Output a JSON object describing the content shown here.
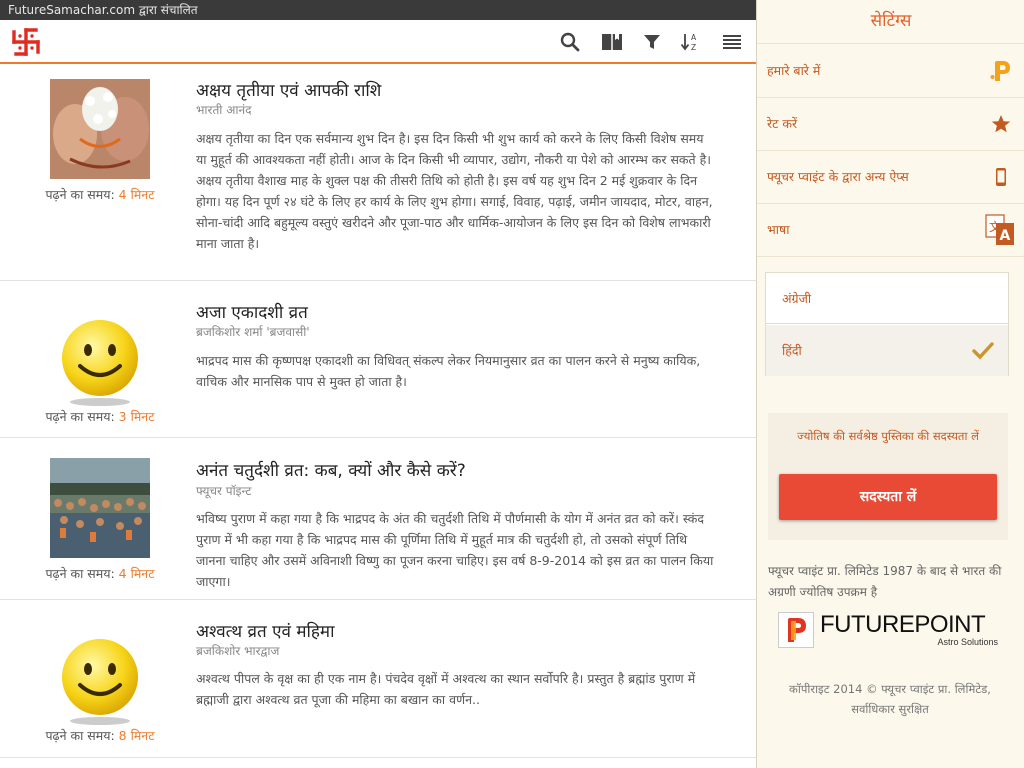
{
  "statusbar": {
    "text": "FutureSamachar.com द्वारा संचालित"
  },
  "toolbar": {
    "icons": [
      "search-icon",
      "book-icon",
      "filter-icon",
      "sort-az-icon",
      "menu-icon"
    ],
    "accent": "#f07a2a",
    "logo_color": "#e02b20",
    "sort_label": "AZ"
  },
  "articles": [
    {
      "title": "अक्षय तृतीया एवं आपकी राशि",
      "author": "भारती आनंद",
      "body": "अक्षय तृतीया का दिन एक सर्वमान्य शुभ दिन है। इस दिन किसी भी शुभ कार्य को करने के लिए किसी विशेष समय या मुहूर्त की आवश्यकता नहीं होती। आज के दिन किसी भी व्यापार, उद्योग, नौकरी या पेशे को आरम्भ कर सकते है। अक्षय तृतीया वैशाख माह के शुक्ल पक्ष की तीसरी तिथि को होती है। इस वर्ष यह शुभ दिन 2 मई शुक्रवार के दिन होगा। यह दिन पूर्ण २४ घंटे के लिए हर कार्य के लिए शुभ होगा। सगाई, विवाह, पढ़ाई, जमीन जायदाद, मोटर, वाहन, सोना-चांदी आदि बहुमूल्य वस्तुएं खरीदने और पूजा-पाठ और धार्मिक-आयोजन के लिए इस दिन को विशेष लाभकारी माना जाता है।",
      "read_label": "पढ़ने का समय:",
      "read_time": "4 मिनट",
      "image": "ritual-photo"
    },
    {
      "title": "अजा एकादशी व्रत",
      "author": "ब्रजकिशोर शर्मा 'ब्रजवासी'",
      "body": "भाद्रपद मास की कृष्णपक्ष एकादशी का विधिवत् संकल्प लेकर नियमानुसार व्रत का पालन करने से मनुष्य कायिक, वाचिक और मानसिक पाप से मुक्त हो जाता है।",
      "read_label": "पढ़ने का समय:",
      "read_time": "3 मिनट",
      "image": "smiley-icon"
    },
    {
      "title": "अनंत चतुर्दशी व्रत: कब, क्यों और कैसे करें?",
      "author": "फ्यूचर पॉइन्ट",
      "body": "भविष्य पुराण में कहा गया है कि भाद्रपद के अंत की चतुर्दशी तिथि में पौर्णमासी के योग में अनंत व्रत को करें। स्कंद पुराण में भी कहा गया है कि भाद्रपद मास की पूर्णिमा तिथि में मुहूर्त मात्र की चतुर्दशी हो, तो उसको संपूर्ण तिथि जानना चाहिए और उसमें अविनाशी विष्णु का पूजन करना चाहिए। इस वर्ष 8-9-2014 को इस व्रत का पालन किया जाएगा।",
      "read_label": "पढ़ने का समय:",
      "read_time": "4 मिनट",
      "image": "crowd-photo"
    },
    {
      "title": "अश्वत्थ व्रत एवं महिमा",
      "author": "ब्रजकिशोर भारद्वाज",
      "body": "अश्वत्थ पीपल के वृक्ष का ही एक नाम है। पंचदेव वृक्षों में अश्वत्थ का स्थान सर्वोपरि है। प्रस्तुत है ब्रह्मांड पुराण में ब्रह्माजी द्वारा अश्वत्थ व्रत पूजा की महिमा का बखान का वर्णन..",
      "read_label": "पढ़ने का समय:",
      "read_time": "8 मिनट",
      "image": "smiley-icon"
    }
  ],
  "drawer": {
    "title": "सेटिंग्स",
    "menu": [
      {
        "label": "हमारे बारे में",
        "icon": "futurepoint-p-icon"
      },
      {
        "label": "रेट करें",
        "icon": "star-icon"
      },
      {
        "label": "फ्यूचर प्वाइंट के द्वारा अन्य ऐप्स",
        "icon": "phone-icon"
      },
      {
        "label": "भाषा",
        "icon": "translate-icon"
      }
    ],
    "languages": [
      {
        "label": "अंग्रेजी",
        "selected": false
      },
      {
        "label": "हिंदी",
        "selected": true
      }
    ],
    "subscribe": {
      "text": "ज्योतिष की सर्वश्रेष्ठ पुस्तिका की सदस्यता लें",
      "button": "सदस्यता लें",
      "button_color": "#e84a35"
    },
    "about": "फ्यूचर प्वाइंट प्रा. लिमिटेड 1987 के बाद से भारत की अग्रणी ज्योतिष उपक्रम है",
    "brand": {
      "name": "FUTUREPOINT",
      "tagline": "Astro Solutions"
    },
    "copyright": "कॉपीराइट 2014 © फ्यूचर प्वाइंट प्रा. लिमिटेड, सर्वाधिकार सुरक्षित"
  }
}
